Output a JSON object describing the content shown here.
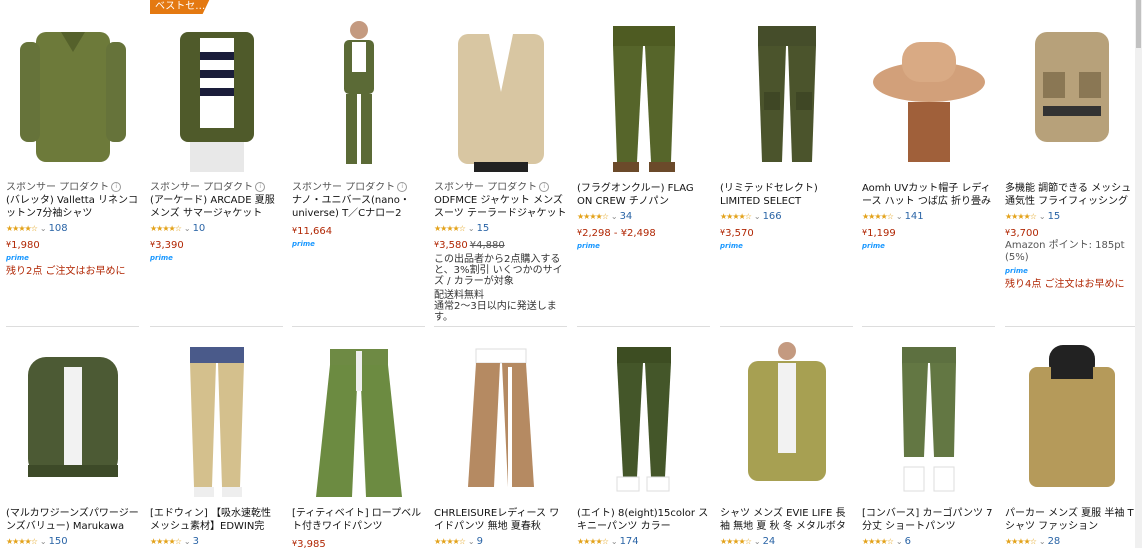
{
  "row1": [
    {
      "image": "olive-shirt",
      "sponsor": "スポンサー プロダクト",
      "title": "(バレッタ) Valletta リネンコットン7分袖シャツ",
      "rating_count": "108",
      "price": "1,980",
      "prime": "prime",
      "stock": "残り2点 ご注文はお早めに"
    },
    {
      "image": "olive-blazer",
      "badge": "ベストセ…",
      "sponsor": "スポンサー プロダクト",
      "title": "(アーケード) ARCADE 夏服 メンズ サマージャケット",
      "rating_count": "10",
      "price": "3,390",
      "prime": "prime"
    },
    {
      "image": "olive-suit",
      "sponsor": "スポンサー プロダクト",
      "title": "ナノ・ユニバース(nano・universe) T／Cナロー2",
      "price": "11,664",
      "prime": "prime"
    },
    {
      "image": "beige-blazer",
      "sponsor": "スポンサー プロダクト",
      "title": "ODFMCE ジャケット メンズ スーツ テーラードジャケット",
      "rating_count": "15",
      "price": "3,580",
      "old_price": "¥4,880",
      "note": "この出品者から2点購入すると、3%割引 いくつかのサイズ / カラーが対象",
      "shipping": "配送料無料",
      "delivery": "通常2～3日以内に発送します。"
    },
    {
      "image": "olive-chinos",
      "title": "(フラグオンクルー) FLAG ON CREW チノパン",
      "rating_count": "34",
      "price": "2,298 - ¥2,498",
      "prime": "prime"
    },
    {
      "image": "cargo-pants",
      "title": "(リミテッドセレクト) LIMITED SELECT",
      "rating_count": "166",
      "price": "3,570",
      "prime": "prime"
    },
    {
      "image": "bucket-hat",
      "title": "Aomh UVカット帽子 レディース ハット つば広 折り畳み",
      "rating_count": "141",
      "price": "1,199",
      "prime": "prime"
    },
    {
      "image": "fishing-vest",
      "title": "多機能 調節できる メッシュ 通気性 フライフィッシング",
      "rating_count": "15",
      "price": "3,700",
      "points": "Amazon ポイント: 185pt (5%)",
      "prime": "prime",
      "stock": "残り4点 ご注文はお早めに"
    }
  ],
  "row2": [
    {
      "image": "olive-bomber",
      "title": "(マルカワジーンズパワージーンズバリュー) Marukawa",
      "rating_count": "150"
    },
    {
      "image": "beige-pants",
      "title": "[エドウィン] 【吸水速乾性 メッシュ素材】EDWIN完",
      "rating_count": "3"
    },
    {
      "image": "green-wide-pants",
      "title": "[ティティベイト] ロープベルト付きワイドパンツ",
      "price": "3,985"
    },
    {
      "image": "tan-wide-pants",
      "title": "CHRLEISUREレディース ワイドパンツ 無地 夏春秋 ",
      "rating_count": "9"
    },
    {
      "image": "skinny-pants",
      "title": "(エイト) 8(eight)15color スキニーパンツ カラー ",
      "rating_count": "174"
    },
    {
      "image": "khaki-shirt",
      "title": "シャツ メンズ EVIE LIFE 長袖 無地 夏 秋 冬 メタルボタン",
      "rating_count": "24"
    },
    {
      "image": "cropped-cargo",
      "title": "[コンバース] カーゴパンツ 7分丈 ショートパンツ ",
      "rating_count": "6"
    },
    {
      "image": "hoodie-tee",
      "title": "パーカー メンズ 夏服 半袖 Tシャツ ファッション",
      "rating_count": "28"
    }
  ]
}
